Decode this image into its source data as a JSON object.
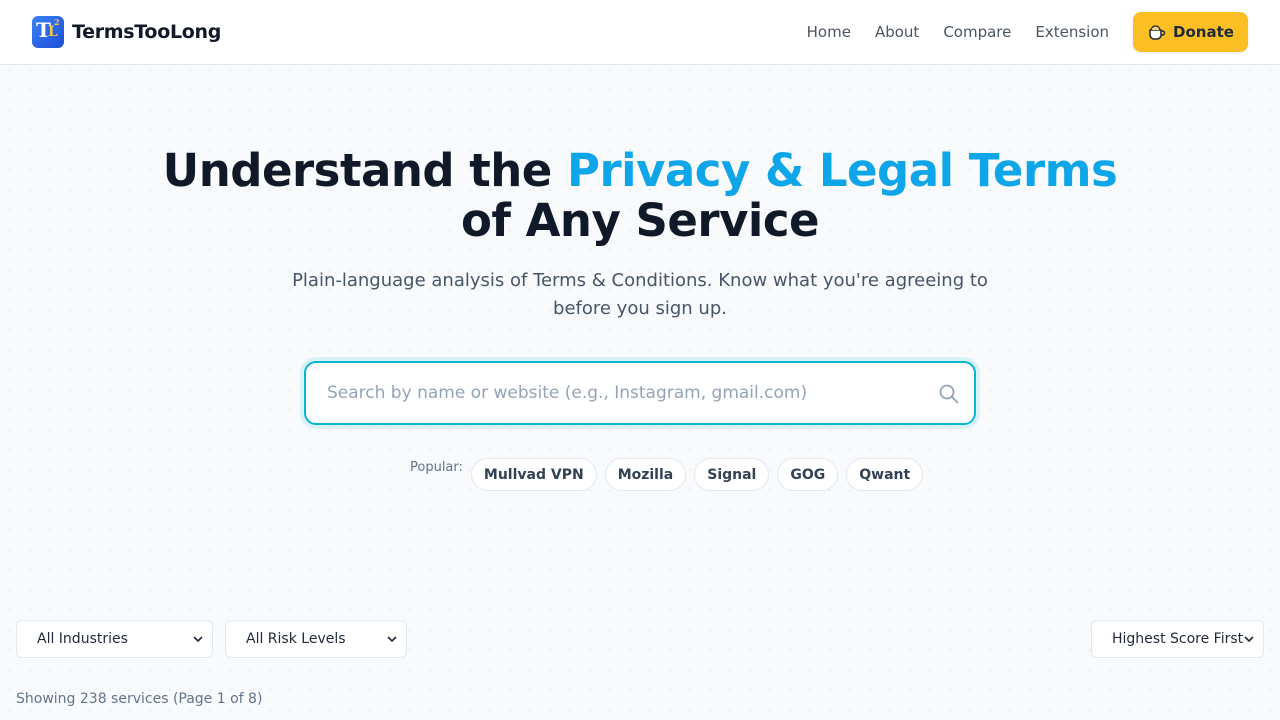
{
  "brand": {
    "name": "TermsTooLong",
    "logo_mark": "T",
    "logo_mark_small": "L",
    "logo_sup": "2"
  },
  "nav": {
    "items": [
      "Home",
      "About",
      "Compare",
      "Extension"
    ],
    "donate_label": "Donate",
    "donate_icon": "coffee-cup-icon"
  },
  "hero": {
    "title_part1": "Understand the ",
    "title_accent": "Privacy & Legal Terms",
    "title_part2": "of Any Service",
    "subtitle": "Plain-language analysis of Terms & Conditions. Know what you're agreeing to before you sign up.",
    "accent_color": "#0ea5e9"
  },
  "search": {
    "value": "",
    "placeholder": "Search by name or website (e.g., Instagram, gmail.com)",
    "icon": "search-icon"
  },
  "popular": {
    "label": "Popular:",
    "items": [
      "Mullvad VPN",
      "Mozilla",
      "Signal",
      "GOG",
      "Qwant"
    ]
  },
  "filters": {
    "industry": "All Industries",
    "risk": "All Risk Levels",
    "sort": "Highest Score First"
  },
  "results": {
    "showing": "Showing 238 services (Page 1 of 8)"
  },
  "colors": {
    "brand_blue": "#2563eb",
    "donate_yellow": "#fbbf24",
    "search_border": "#06b6d4"
  }
}
